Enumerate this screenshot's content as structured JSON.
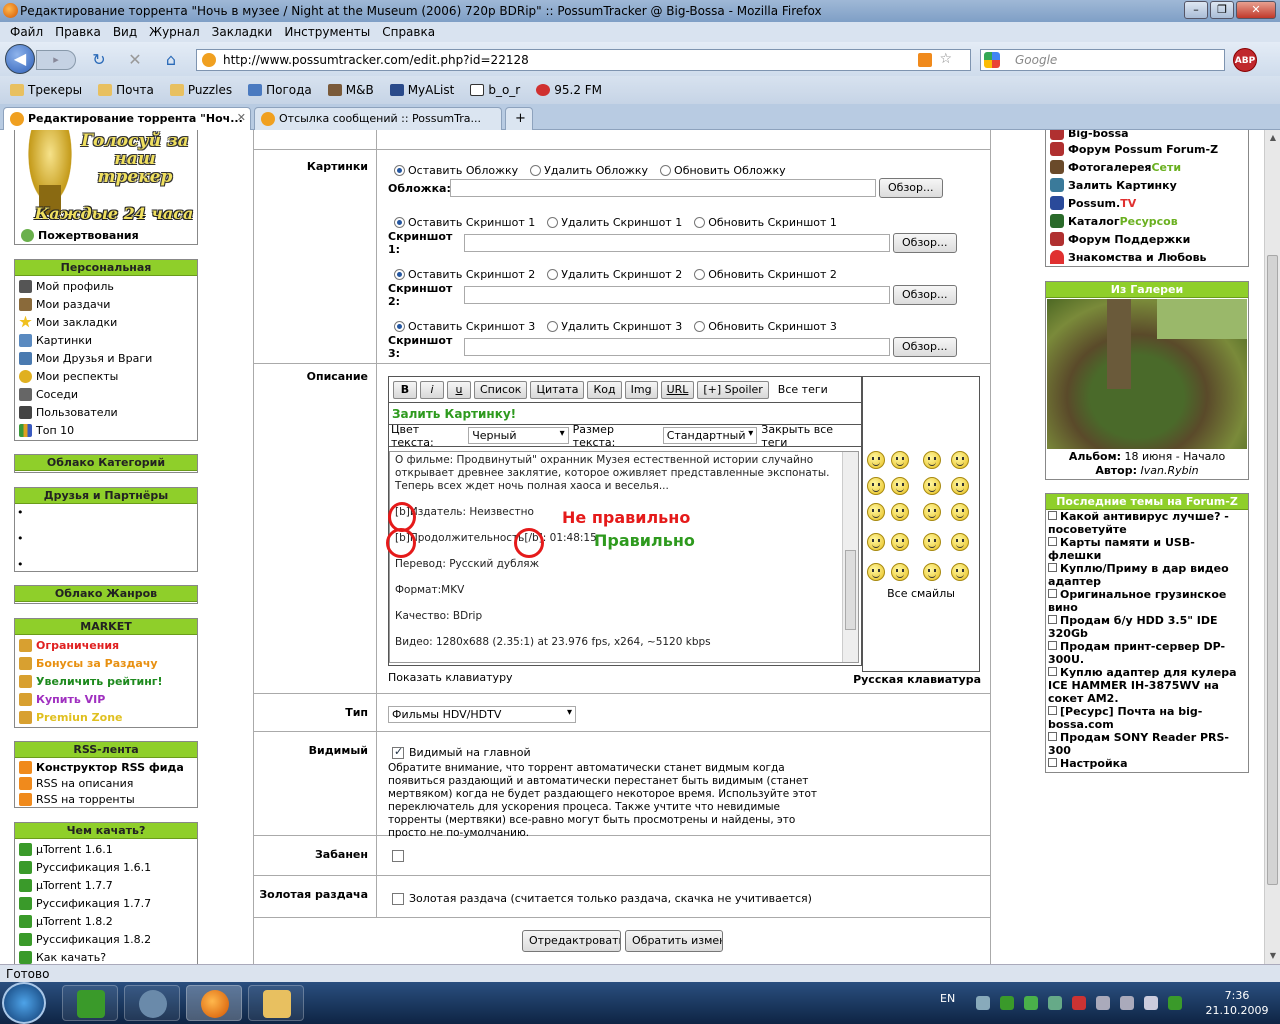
{
  "window": {
    "title": "Редактирование торрента \"Ночь в музее / Night at the Museum (2006) 720p BDRip\" :: PossumTracker @ Big-Bossa - Mozilla Firefox",
    "minimize": "–",
    "maximize": "❐",
    "close": "✕"
  },
  "menu": [
    "Файл",
    "Правка",
    "Вид",
    "Журнал",
    "Закладки",
    "Инструменты",
    "Справка"
  ],
  "nav": {
    "url": "http://www.possumtracker.com/edit.php?id=22128",
    "search_placeholder": "Google",
    "abp": "ABP",
    "back": "◀",
    "forward": "▸",
    "reload": "↻",
    "stop": "✕",
    "home": "⌂"
  },
  "bookmarks": [
    "Трекеры",
    "Почта",
    "Puzzles",
    "Погода",
    "M&B",
    "MyAList",
    "b_o_r",
    "95.2 FM"
  ],
  "tabs": [
    {
      "label": "Редактирование торрента \"Ноч...",
      "active": true
    },
    {
      "label": "Отсылка сообщений :: PossumTra...",
      "active": false
    }
  ],
  "tabs_new": "+",
  "left": {
    "vote_line": "Голосуй за наш трекер",
    "vote_sub": "Каждые 24 часа",
    "donate": "Пожертвования",
    "personal_title": "Персональная",
    "personal": [
      "Мой профиль",
      "Мои раздачи",
      "Мои закладки",
      "Картинки",
      "Мои Друзья и Враги",
      "Мои респекты",
      "Соседи",
      "Пользователи",
      "Топ 10"
    ],
    "categories_title": "Облако Категорий",
    "friends_title": "Друзья и Партнёры",
    "bullet": "•",
    "genres_title": "Облако Жанров",
    "market_title": "MARKET",
    "market": [
      {
        "label": "Ограничения",
        "color": "#e02020"
      },
      {
        "label": "Бонусы за Раздачу",
        "color": "#e89010"
      },
      {
        "label": "Увеличить рейтинг!",
        "color": "#1e8a1e"
      },
      {
        "label": "Купить VIP",
        "color": "#a030c0"
      },
      {
        "label": "Premiun Zone",
        "color": "#e0c020"
      }
    ],
    "rss_title": "RSS-лента",
    "rss": [
      "Конструктор RSS фида",
      "RSS на описания",
      "RSS на торренты"
    ],
    "what_title": "Чем качать?",
    "what": [
      "µTorrent 1.6.1",
      "Руссификация 1.6.1",
      "µTorrent 1.7.7",
      "Руссификация 1.7.7",
      "µTorrent 1.8.2",
      "Руссификация 1.8.2",
      "Как качать?"
    ]
  },
  "form": {
    "pictures_label": "Картинки",
    "cover": {
      "keep": "Оставить Обложку",
      "delete": "Удалить Обложку",
      "update": "Обновить Обложку",
      "label": "Обложка:"
    },
    "shots": [
      {
        "keep": "Оставить Скриншот 1",
        "delete": "Удалить Скриншот 1",
        "update": "Обновить Скриншот 1",
        "label": "Скриншот 1:"
      },
      {
        "keep": "Оставить Скриншот 2",
        "delete": "Удалить Скриншот 2",
        "update": "Обновить Скриншот 2",
        "label": "Скриншот 2:"
      },
      {
        "keep": "Оставить Скриншот 3",
        "delete": "Удалить Скриншот 3",
        "update": "Обновить Скриншот 3",
        "label": "Скриншот 3:"
      }
    ],
    "browse": "Обзор...",
    "desc_label": "Описание",
    "toolbar": [
      "B",
      "i",
      "u",
      "Список",
      "Цитата",
      "Код",
      "Img",
      "URL",
      "[+] Spoiler"
    ],
    "all_tags": "Все теги",
    "upload_picture": "Залить Картинку!",
    "text_color_label": "Цвет текста:",
    "text_color": "Черный",
    "text_size_label": "Размер текста:",
    "text_size": "Стандартный",
    "close_tags": "Закрыть все теги",
    "description": {
      "para1": "О фильме: Продвинутый\" охранник Музея естественной истории случайно открывает древнее заклятие, которое оживляет представленные экспонаты. Теперь всех ждет ночь полная хаоса и веселья...",
      "line1": "[b]Издатель: Неизвестно",
      "line2": "[b]Продолжительность[/b]: 01:48:15",
      "line3": "Перевод: Русский дубляж",
      "line4": "Формат:MKV",
      "line5": "Качество: BDrip",
      "line6": "Видео: 1280x688 (2.35:1) at 23.976 fps, x264, ~5120 kbps"
    },
    "annot_wrong": "Не правильно",
    "annot_right": "Правильно",
    "show_keyboard": "Показать клавиатуру",
    "all_smiles": "Все смайлы",
    "russian_keyboard": "Русская клавиатура",
    "type_label": "Тип",
    "type_value": "Фильмы HDV/HDTV",
    "visible_label": "Видимый",
    "visible_check": "Видимый на главной",
    "visible_note": "Обратите внимание, что торрент автоматически станет видмым когда появиться раздающий и автоматически перестанет быть видимым (станет мертвяком) когда не будет раздающего некоторое время. Используйте этот переключатель для ускорения процеса. Также учтите что невидимые торренты (мертвяки) все-равно могут быть просмотрены и найдены, это просто не по-умолчанию.",
    "banned_label": "Забанен",
    "gold_label": "Золотая раздача",
    "gold_check": "Золотая раздача (считается только раздача, скачка не учитивается)",
    "submit": "Отредактровать",
    "revert": "Обратить изменения"
  },
  "right": {
    "links": [
      {
        "label": "Big-bossa",
        "extra": ""
      },
      {
        "label": "Форум Possum Forum-Z",
        "extra": ""
      },
      {
        "label": "Фотогалерея ",
        "extra": "Сети"
      },
      {
        "label": "Залить Картинку",
        "extra": ""
      },
      {
        "label": "Possum.",
        "extra": "TV"
      },
      {
        "label": "Каталог ",
        "extra": "Ресурсов"
      },
      {
        "label": "Форум Поддержки",
        "extra": ""
      },
      {
        "label": "Знакомства и Любовь",
        "extra": ""
      }
    ],
    "gallery_title": "Из Галереи",
    "album_label": "Альбом:",
    "album": "18 июня - Начало",
    "author_label": "Автор:",
    "author": "Ivan.Rybin",
    "forum_title": "Последние темы на Forum-Z",
    "topics": [
      "Какой антивирус лучше? - посоветуйте",
      "Карты памяти и USB-флешки",
      "Куплю/Приму в дар видео адаптер",
      "Оригинальное грузинское вино",
      "Продам б/у HDD 3.5\" IDE 320Gb",
      "Продам принт-сервер DP-300U.",
      "Куплю адаптер для кулера ICE HAMMER IH-3875WV на сокет AM2.",
      "[Ресурс] Почта на big-bossa.com",
      "Продам SONY Reader PRS-300",
      "Настройка"
    ]
  },
  "status": "Готово",
  "taskbar": {
    "lang": "EN",
    "time": "7:36",
    "date": "21.10.2009"
  },
  "colors": {
    "accent_green": "#8fcf2a",
    "annotation_red": "#e51a1a",
    "annotation_green": "#2e9a1e"
  }
}
